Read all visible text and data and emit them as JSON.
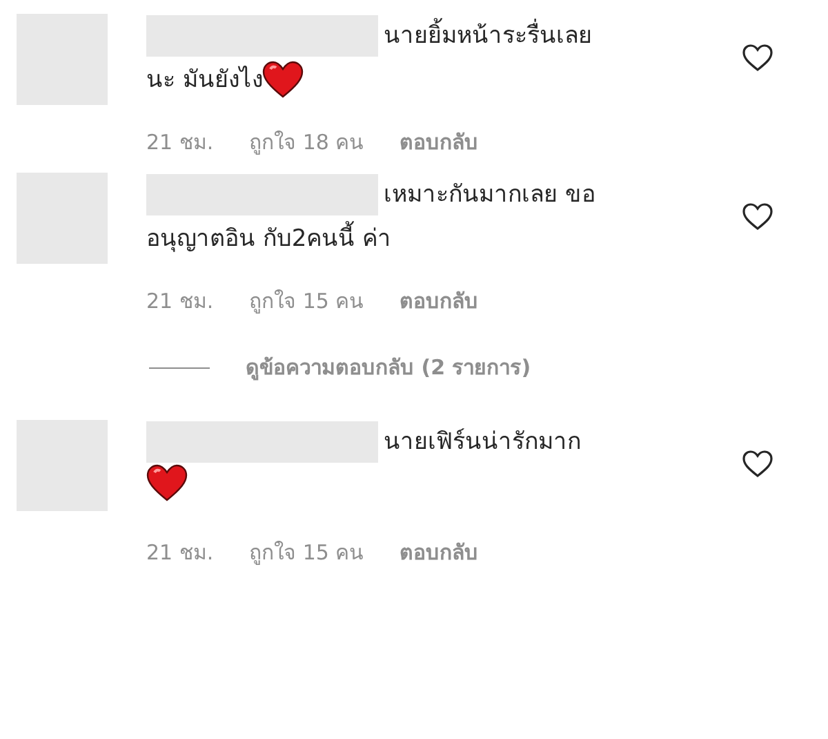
{
  "comments": [
    {
      "lines": [
        "นายยิ้มหน้าระรื่นเลย",
        "นะ มันยังไง"
      ],
      "heart_emoji": true,
      "heart_new_line": false,
      "liked": false,
      "time": "21 ชม.",
      "likes": "ถูกใจ 18 คน",
      "reply": "ตอบกลับ"
    },
    {
      "lines": [
        "เหมาะกันมากเลย ขอ",
        "อนุญาตอิน กับ2คนนี้ ค่า"
      ],
      "liked": false,
      "time": "21 ชม.",
      "likes": "ถูกใจ 15 คน",
      "reply": "ตอบกลับ",
      "view_replies": "ดูข้อความตอบกลับ (2 รายการ)"
    },
    {
      "lines": [
        "นายเฟิร์นน่ารักมาก"
      ],
      "heart_emoji": true,
      "heart_new_line": true,
      "liked": false,
      "time": "21 ชม.",
      "likes": "ถูกใจ 15 คน",
      "reply": "ตอบกลับ"
    }
  ]
}
